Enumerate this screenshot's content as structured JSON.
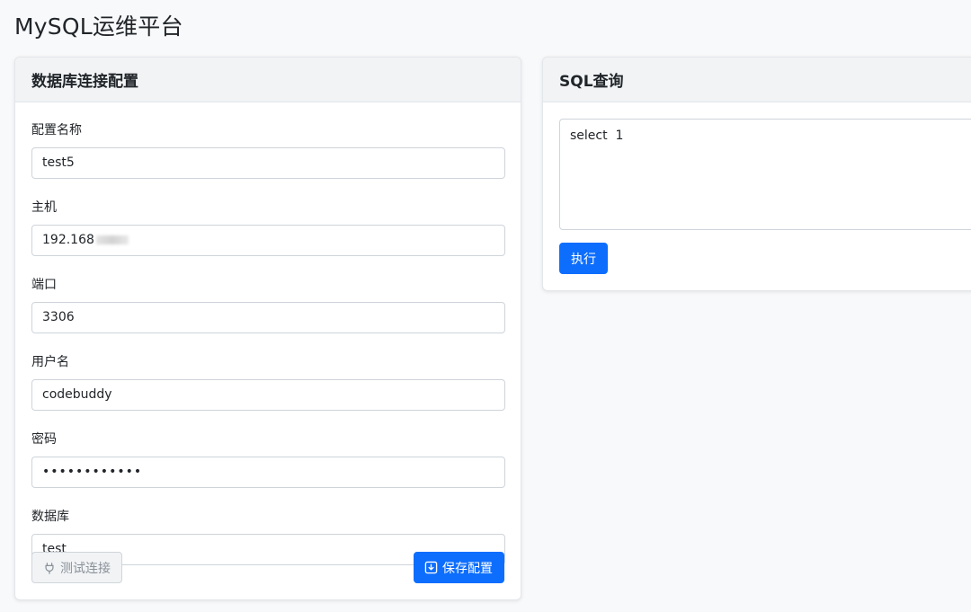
{
  "app": {
    "title": "MySQL运维平台"
  },
  "config_card": {
    "title": "数据库连接配置",
    "fields": {
      "name": {
        "label": "配置名称",
        "value": "test5"
      },
      "host": {
        "label": "主机",
        "value": "192.168"
      },
      "port": {
        "label": "端口",
        "value": "3306"
      },
      "user": {
        "label": "用户名",
        "value": "codebuddy"
      },
      "password": {
        "label": "密码",
        "value": "••••••••••••"
      },
      "database": {
        "label": "数据库",
        "value": "test"
      }
    },
    "buttons": {
      "test": {
        "label": "测试连接",
        "icon": "plug-icon"
      },
      "save": {
        "label": "保存配置",
        "icon": "save-icon"
      }
    }
  },
  "sql_card": {
    "title": "SQL查询",
    "query": "select  1",
    "execute_label": "执行"
  },
  "colors": {
    "primary": "#0d6efd",
    "background": "#f8f9fa",
    "header_bg": "#f1f3f5",
    "border": "#ced4da"
  }
}
